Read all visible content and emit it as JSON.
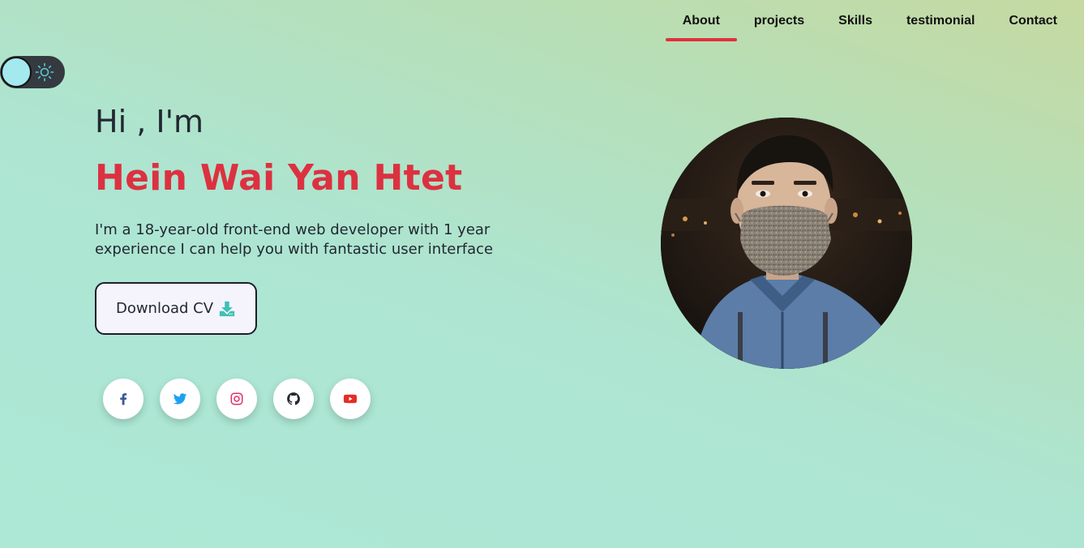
{
  "nav": {
    "items": [
      {
        "label": "About",
        "active": true
      },
      {
        "label": "projects",
        "active": false
      },
      {
        "label": "Skills",
        "active": false
      },
      {
        "label": "testimonial",
        "active": false
      },
      {
        "label": "Contact",
        "active": false
      }
    ]
  },
  "theme_toggle": {
    "state": "light",
    "icon": "sun-icon"
  },
  "hero": {
    "greeting": "Hi , I'm",
    "name": "Hein Wai Yan Htet",
    "bio": "I'm a 18-year-old front-end web developer with 1 year experience I can help you with fantastic user interface",
    "download_label": "Download CV",
    "download_icon": "download-icon"
  },
  "socials": [
    {
      "icon": "facebook-icon",
      "color": "#3b5998"
    },
    {
      "icon": "twitter-icon",
      "color": "#1da1f2"
    },
    {
      "icon": "instagram-icon",
      "color": "#e1306c"
    },
    {
      "icon": "github-icon",
      "color": "#24292e"
    },
    {
      "icon": "youtube-icon",
      "color": "#e52d27"
    }
  ],
  "colors": {
    "accent": "#dc3140",
    "nav_underline": "#e0303f",
    "toggle_bg": "#343a40",
    "toggle_knob": "#a3e9ee",
    "download_icon": "#3fc1b4"
  }
}
